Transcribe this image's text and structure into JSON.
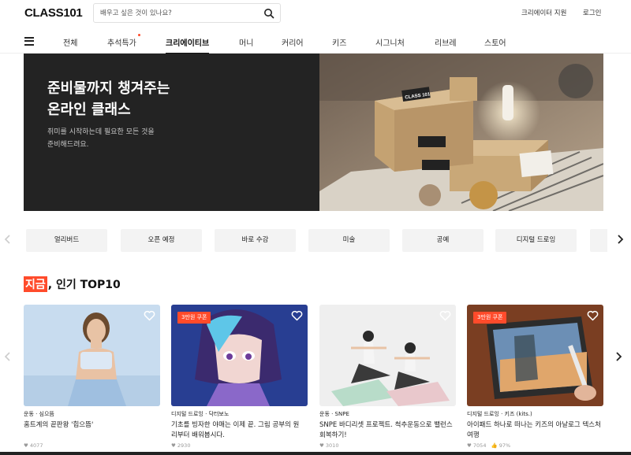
{
  "header": {
    "logo": "CLASS101",
    "search_placeholder": "배우고 싶은 것이 있나요?",
    "creator_link": "크리에이터 지원",
    "login_link": "로그인"
  },
  "nav": {
    "items": [
      {
        "label": "전체"
      },
      {
        "label": "추석특가"
      },
      {
        "label": "크리에이티브"
      },
      {
        "label": "머니"
      },
      {
        "label": "커리어"
      },
      {
        "label": "키즈"
      },
      {
        "label": "시그니처"
      },
      {
        "label": "리브레"
      },
      {
        "label": "스토어"
      }
    ],
    "active_index": 2
  },
  "hero": {
    "title_line1": "준비물까지 챙겨주는",
    "title_line2": "온라인 클래스",
    "sub_line1": "취미를 시작하는데 필요한 모든 것을",
    "sub_line2": "준비해드려요.",
    "box_label": "CLASS 101"
  },
  "categories": [
    "얼리버드",
    "오픈 예정",
    "바로 수강",
    "미술",
    "공예",
    "디지털 드로잉"
  ],
  "section": {
    "title_highlight": "지금",
    "title_rest": ", 인기 TOP10"
  },
  "cards": [
    {
      "meta": "운동 · 심으뜸",
      "title": "홈트계의 끝판왕 '힙으뜸'",
      "likes": "4077",
      "coupon": ""
    },
    {
      "meta": "디지털 드로잉 · 닥터보노",
      "title": "기초를 빙자한 야매는 이제 끝. 그림 공부의 원리부터 배워봅시다.",
      "likes": "2930",
      "coupon": "3만원 쿠폰"
    },
    {
      "meta": "운동 · SNPE",
      "title": "SNPE 바디리셋 프로젝트. 척추운동으로 밸런스 회복하기!",
      "likes": "3010",
      "coupon": ""
    },
    {
      "meta": "디지털 드로잉 · 키즈 (kits.)",
      "title": "아이패드 하나로 떠나는 키즈의 아날로그 텍스처 여행",
      "likes": "7054",
      "rating": "97%",
      "coupon": "3만원 쿠폰"
    }
  ],
  "colors": {
    "accent": "#ff4b2b",
    "hero_bg": "#232323"
  }
}
